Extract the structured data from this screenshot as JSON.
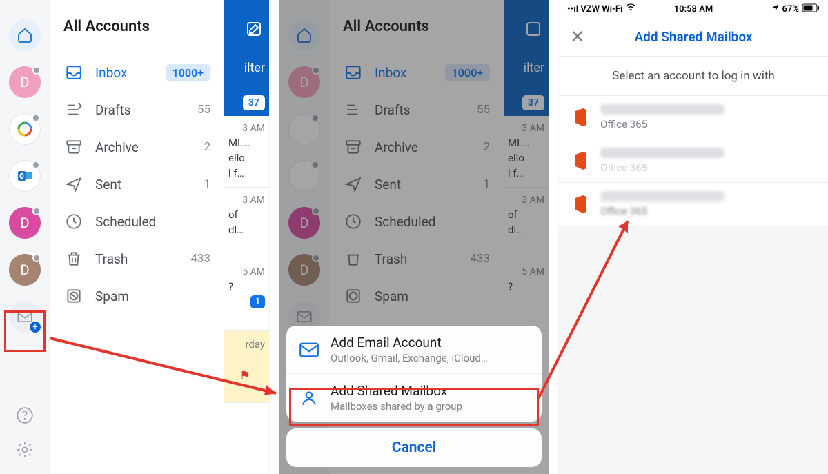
{
  "title": "All Accounts",
  "folders": [
    {
      "id": "inbox",
      "label": "Inbox",
      "count": "1000+",
      "active": true,
      "badge": true
    },
    {
      "id": "drafts",
      "label": "Drafts",
      "count": "55"
    },
    {
      "id": "archive",
      "label": "Archive",
      "count": "2"
    },
    {
      "id": "sent",
      "label": "Sent",
      "count": "1"
    },
    {
      "id": "scheduled",
      "label": "Scheduled",
      "count": ""
    },
    {
      "id": "trash",
      "label": "Trash",
      "count": "433"
    },
    {
      "id": "spam",
      "label": "Spam",
      "count": ""
    }
  ],
  "accounts_rail": [
    "home",
    "pinkD",
    "google",
    "outlook",
    "magenta",
    "brown",
    "add"
  ],
  "peek": {
    "filter": "ilter",
    "chip": "37",
    "rows": [
      {
        "time": "3 AM",
        "line1": "ML…",
        "line2": "ello",
        "line3": "l f…"
      },
      {
        "time": "3 AM",
        "line1": "of",
        "line2": "dl…",
        "line3": ""
      },
      {
        "time": "5 AM",
        "line1": "?",
        "line2": "",
        "line3": ""
      }
    ],
    "blue_chip": "1",
    "yellow": "rday"
  },
  "action_sheet": {
    "add_email": {
      "title": "Add Email Account",
      "sub": "Outlook, Gmail, Exchange, iCloud…"
    },
    "add_shared": {
      "title": "Add Shared Mailbox",
      "sub": "Mailboxes shared by a group"
    },
    "cancel": "Cancel"
  },
  "picker": {
    "status_left": "VZW Wi-Fi",
    "status_time": "10:58 AM",
    "status_batt": "67%",
    "nav_title": "Add Shared Mailbox",
    "sub": "Select an account to log in with",
    "provider": "Office 365"
  }
}
